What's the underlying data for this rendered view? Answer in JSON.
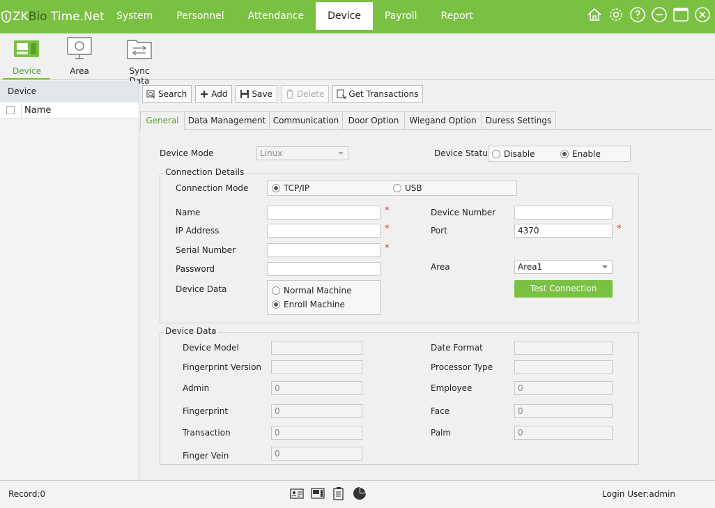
{
  "app": {
    "logo_zk": "ZK",
    "logo_bio": "Bio",
    "logo_rest": " Time.Net"
  },
  "nav": [
    "System",
    "Personnel",
    "Attendance",
    "Device",
    "Payroll",
    "Report"
  ],
  "ribbon": {
    "device": "Device",
    "area": "Area",
    "sync": "Sync Data"
  },
  "left_panel": {
    "header": "Device",
    "col_name": "Name"
  },
  "toolbar": {
    "search": "Search",
    "add": "Add",
    "save": "Save",
    "delete": "Delete",
    "get_transactions": "Get Transactions"
  },
  "tabs": [
    "General",
    "Data Management",
    "Communication",
    "Door Option",
    "Wiegand Option",
    "Duress Settings"
  ],
  "general": {
    "device_mode_label": "Device Mode",
    "device_mode_value": "Linux",
    "device_status_label": "Device Status",
    "status_disable": "Disable",
    "status_enable": "Enable",
    "connection_details_title": "Connection Details",
    "connection_mode_label": "Connection Mode",
    "mode_tcpip": "TCP/IP",
    "mode_usb": "USB",
    "name_label": "Name",
    "ip_label": "IP Address",
    "serial_label": "Serial Number",
    "password_label": "Password",
    "device_data_label": "Device Data",
    "normal_machine": "Normal Machine",
    "enroll_machine": "Enroll Machine",
    "device_number_label": "Device Number",
    "port_label": "Port",
    "port_value": "4370",
    "area_label": "Area",
    "area_value": "Area1",
    "test_connection": "Test Connection",
    "required_mark": "*"
  },
  "device_data": {
    "title": "Device Data",
    "device_model": "Device Model",
    "fingerprint_version": "Fingerprint Version",
    "admin": "Admin",
    "admin_value": "0",
    "fingerprint": "Fingerprint",
    "fingerprint_value": "0",
    "transaction": "Transaction",
    "transaction_value": "0",
    "finger_vein": "Finger Vein",
    "finger_vein_value": "0",
    "date_format": "Date Format",
    "processor_type": "Processor Type",
    "employee": "Employee",
    "employee_value": "0",
    "face": "Face",
    "face_value": "0",
    "palm": "Palm",
    "palm_value": "0"
  },
  "status_bar": {
    "record": "Record:0",
    "login_user": "Login User:admin"
  },
  "colors": {
    "accent": "#7ac143",
    "active_text": "#5a9e2a",
    "required": "#d33333"
  }
}
